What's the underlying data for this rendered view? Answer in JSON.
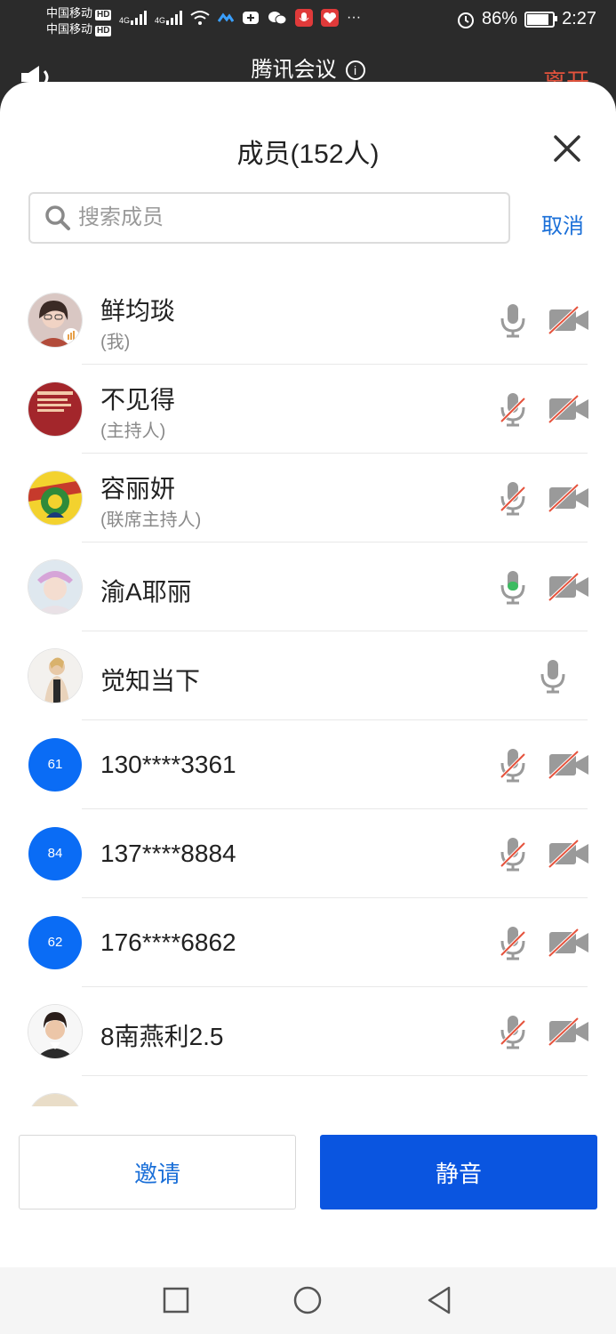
{
  "status_bar": {
    "carrier1": "中国移动",
    "carrier2": "中国移动",
    "hd": "HD",
    "net1": "4G",
    "net2": "4G",
    "battery": "86%",
    "time": "2:27"
  },
  "meeting": {
    "app_title": "腾讯会议",
    "leave_label": "离开"
  },
  "panel": {
    "title": "成员(152人)",
    "search_placeholder": "搜索成员",
    "cancel_label": "取消"
  },
  "members": [
    {
      "name": "鲜均琰",
      "role": "(我)",
      "mic": "on",
      "camera": "off"
    },
    {
      "name": "不见得",
      "role": "(主持人)",
      "mic": "muted",
      "camera": "off"
    },
    {
      "name": "容丽妍",
      "role": "(联席主持人)",
      "mic": "muted",
      "camera": "off"
    },
    {
      "name": "渝A耶丽",
      "role": "",
      "mic": "speaking",
      "camera": "off"
    },
    {
      "name": "觉知当下",
      "role": "",
      "mic": "on",
      "camera": "none"
    },
    {
      "name": "130****3361",
      "avatar_text": "61",
      "mic": "muted",
      "camera": "off"
    },
    {
      "name": "137****8884",
      "avatar_text": "84",
      "mic": "muted",
      "camera": "off"
    },
    {
      "name": "176****6862",
      "avatar_text": "62",
      "mic": "muted",
      "camera": "off"
    },
    {
      "name": "8南燕利2.5",
      "role": "",
      "mic": "muted",
      "camera": "off"
    }
  ],
  "actions": {
    "invite_label": "邀请",
    "mute_label": "静音"
  },
  "colors": {
    "accent": "#1a6fd8",
    "mute_button": "#0a55e0",
    "avatar_blue": "#0a6cf5",
    "muted_slash": "#e5533d",
    "speaking": "#3dbb61"
  }
}
